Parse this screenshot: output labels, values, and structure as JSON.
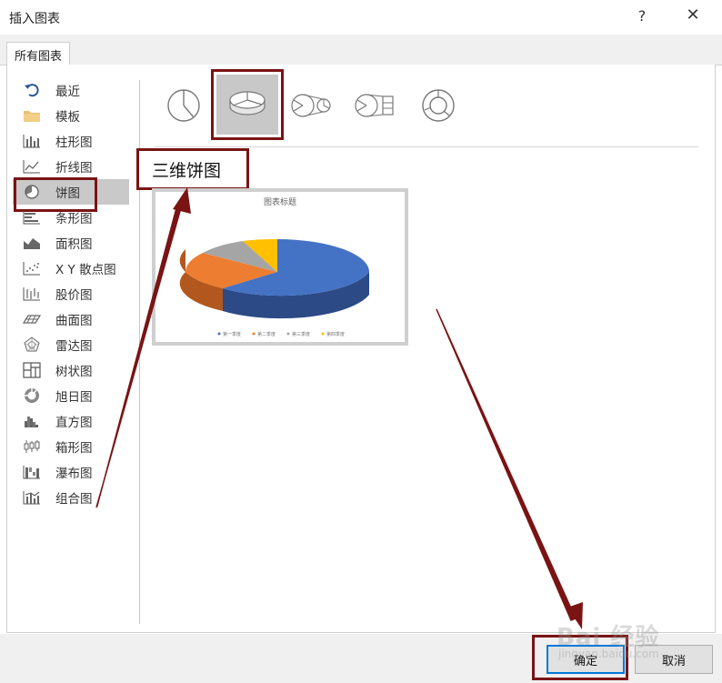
{
  "window": {
    "title": "插入图表",
    "help_label": "?",
    "close_label": "✕"
  },
  "tabs": [
    {
      "label": "所有图表",
      "active": true
    }
  ],
  "sidebar": {
    "items": [
      {
        "label": "最近",
        "icon": "undo-icon"
      },
      {
        "label": "模板",
        "icon": "folder-icon"
      },
      {
        "label": "柱形图",
        "icon": "column-chart-icon"
      },
      {
        "label": "折线图",
        "icon": "line-chart-icon"
      },
      {
        "label": "饼图",
        "icon": "pie-chart-icon",
        "selected": true
      },
      {
        "label": "条形图",
        "icon": "bar-chart-icon"
      },
      {
        "label": "面积图",
        "icon": "area-chart-icon"
      },
      {
        "label": "X Y 散点图",
        "icon": "scatter-chart-icon"
      },
      {
        "label": "股价图",
        "icon": "stock-chart-icon"
      },
      {
        "label": "曲面图",
        "icon": "surface-chart-icon"
      },
      {
        "label": "雷达图",
        "icon": "radar-chart-icon"
      },
      {
        "label": "树状图",
        "icon": "treemap-icon"
      },
      {
        "label": "旭日图",
        "icon": "sunburst-icon"
      },
      {
        "label": "直方图",
        "icon": "histogram-icon"
      },
      {
        "label": "箱形图",
        "icon": "box-whisker-icon"
      },
      {
        "label": "瀑布图",
        "icon": "waterfall-icon"
      },
      {
        "label": "组合图",
        "icon": "combo-chart-icon"
      }
    ]
  },
  "subtypes": [
    {
      "icon": "pie-icon"
    },
    {
      "icon": "pie-3d-icon",
      "selected": true
    },
    {
      "icon": "pie-of-pie-icon"
    },
    {
      "icon": "bar-of-pie-icon"
    },
    {
      "icon": "doughnut-icon"
    }
  ],
  "selected_subtype_title": "三维饼图",
  "preview": {
    "title": "图表标题",
    "legend": [
      "第一季度",
      "第二季度",
      "第三季度",
      "第四季度"
    ],
    "colors": [
      "#4472c4",
      "#ed7d31",
      "#a5a5a5",
      "#ffc000"
    ],
    "side_colors": [
      "#2b4a86",
      "#b2581f",
      "#787878",
      "#c79600"
    ]
  },
  "footer": {
    "ok_label": "确定",
    "cancel_label": "取消"
  },
  "annotation_color": "#7a1414",
  "watermark": {
    "brand": "Bai 经验",
    "url": "jingyan.baidu.com"
  }
}
